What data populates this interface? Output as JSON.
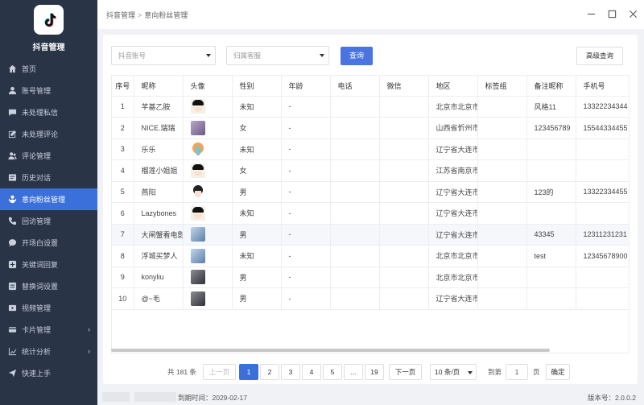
{
  "app": {
    "name": "抖音管理"
  },
  "sidebar": {
    "items": [
      {
        "label": "首页",
        "icon": "home-icon"
      },
      {
        "label": "账号管理",
        "icon": "user-icon"
      },
      {
        "label": "未处理私信",
        "icon": "message-icon"
      },
      {
        "label": "未处理评论",
        "icon": "edit-icon"
      },
      {
        "label": "评论管理",
        "icon": "users-icon"
      },
      {
        "label": "历史对话",
        "icon": "history-icon"
      },
      {
        "label": "意向粉丝管理",
        "icon": "fans-icon",
        "active": true
      },
      {
        "label": "回访管理",
        "icon": "phone-icon"
      },
      {
        "label": "开场白设置",
        "icon": "chat-icon"
      },
      {
        "label": "关键词回复",
        "icon": "reply-icon"
      },
      {
        "label": "替换词设置",
        "icon": "swap-icon"
      },
      {
        "label": "视频管理",
        "icon": "video-icon"
      },
      {
        "label": "卡片管理",
        "icon": "card-icon",
        "expandable": true
      },
      {
        "label": "统计分析",
        "icon": "chart-icon",
        "expandable": true
      },
      {
        "label": "快速上手",
        "icon": "send-icon"
      }
    ]
  },
  "header": {
    "crumb_root": "抖音管理",
    "crumb_sep": ">",
    "crumb_current": "意向粉丝管理"
  },
  "filters": {
    "account_placeholder": "抖音账号",
    "agent_placeholder": "归属客服",
    "search_label": "查询",
    "advanced_label": "高级查询"
  },
  "table": {
    "columns": [
      "序号",
      "昵称",
      "头像",
      "性别",
      "年龄",
      "电话",
      "微信",
      "地区",
      "标签组",
      "备注昵称",
      "手机号"
    ],
    "rows": [
      {
        "idx": "1",
        "nick": "芊基乙胺",
        "avatar": "face",
        "gender": "未知",
        "age": "-",
        "phone": "",
        "wechat": "",
        "region": "北京市北京市",
        "tags": "",
        "remark": "风格11",
        "mobile": "13322234344"
      },
      {
        "idx": "2",
        "nick": "NICE.瑞瑞",
        "avatar": "purple",
        "gender": "女",
        "age": "-",
        "phone": "",
        "wechat": "",
        "region": "山西省忻州市",
        "tags": "",
        "remark": "123456789",
        "mobile": "15544334455"
      },
      {
        "idx": "3",
        "nick": "乐乐",
        "avatar": "elephant",
        "gender": "未知",
        "age": "-",
        "phone": "",
        "wechat": "",
        "region": "辽宁省大连市",
        "tags": "",
        "remark": "",
        "mobile": ""
      },
      {
        "idx": "4",
        "nick": "榴莲小姐姐",
        "avatar": "face",
        "gender": "女",
        "age": "-",
        "phone": "",
        "wechat": "",
        "region": "江苏省南京市",
        "tags": "",
        "remark": "",
        "mobile": ""
      },
      {
        "idx": "5",
        "nick": "燕阳",
        "avatar": "girl",
        "gender": "男",
        "age": "-",
        "phone": "",
        "wechat": "",
        "region": "辽宁省大连市",
        "tags": "",
        "remark": "123的",
        "mobile": "13322334455"
      },
      {
        "idx": "6",
        "nick": "Lazybones",
        "avatar": "face",
        "gender": "未知",
        "age": "-",
        "phone": "",
        "wechat": "",
        "region": "辽宁省大连市",
        "tags": "",
        "remark": "",
        "mobile": ""
      },
      {
        "idx": "7",
        "nick": "大闸蟹看电影",
        "avatar": "blue",
        "gender": "男",
        "age": "-",
        "phone": "",
        "wechat": "",
        "region": "辽宁省大连市",
        "tags": "",
        "remark": "43345",
        "mobile": "12311231231",
        "highlight": true
      },
      {
        "idx": "8",
        "nick": "浮城买梦人",
        "avatar": "blue",
        "gender": "未知",
        "age": "-",
        "phone": "",
        "wechat": "",
        "region": "北京市北京市",
        "tags": "",
        "remark": "test",
        "mobile": "12345678900"
      },
      {
        "idx": "9",
        "nick": "konyliu",
        "avatar": "dark",
        "gender": "男",
        "age": "-",
        "phone": "",
        "wechat": "",
        "region": "北京市北京市",
        "tags": "",
        "remark": "",
        "mobile": ""
      },
      {
        "idx": "10",
        "nick": "@~毛",
        "avatar": "dark",
        "gender": "男",
        "age": "-",
        "phone": "",
        "wechat": "",
        "region": "辽宁省大连市",
        "tags": "",
        "remark": "",
        "mobile": ""
      }
    ]
  },
  "pagination": {
    "total": "共 181 条",
    "prev": "上一页",
    "pages": [
      "1",
      "2",
      "3",
      "4",
      "5",
      "...",
      "19"
    ],
    "current": "1",
    "next": "下一页",
    "page_size": "10 条/页",
    "goto_label": "到第",
    "goto_value": "1",
    "page_unit": "页",
    "confirm": "确定"
  },
  "footer": {
    "expire": "到期时间：2029-02-17",
    "version": "版本号：2.0.0.2"
  }
}
